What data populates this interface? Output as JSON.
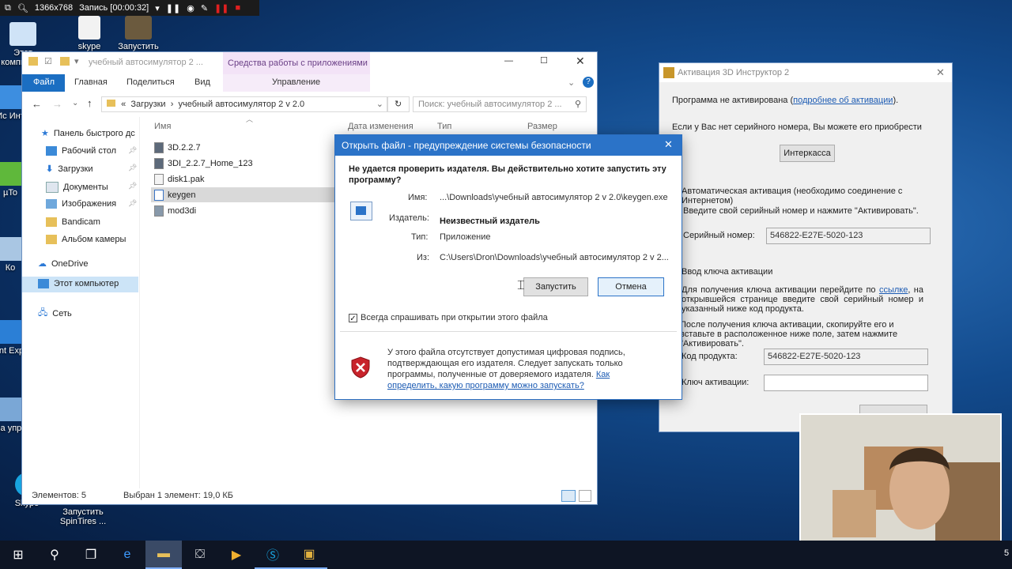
{
  "recorder": {
    "resolution": "1366x768",
    "status": "Запись [00:00:32]"
  },
  "desktop": {
    "icons_left": [
      "Этот компьютер",
      "Ис Инт",
      "µTo",
      "Ко",
      "Int Exp",
      "Па упра",
      "Skype"
    ],
    "icons_top": [
      "skype",
      "Запустить"
    ],
    "bottom_icon": "Запустить SpinTires ..."
  },
  "explorer": {
    "title": "учебный автосимулятор 2 ...",
    "context_tab": "Средства работы с приложениями",
    "tabs": [
      "Файл",
      "Главная",
      "Поделиться",
      "Вид"
    ],
    "context_sub": "Управление",
    "breadcrumb": [
      "«",
      "Загрузки",
      "›",
      "учебный автосимулятор 2 v 2.0"
    ],
    "search_placeholder": "Поиск: учебный автосимулятор 2 ...",
    "nav": {
      "quick_access": "Панель быстрого дс",
      "items": [
        "Рабочий стол",
        "Загрузки",
        "Документы",
        "Изображения",
        "Bandicam",
        "Альбом камеры"
      ],
      "onedrive": "OneDrive",
      "this_pc": "Этот компьютер",
      "network": "Сеть"
    },
    "columns": [
      "Имя",
      "Дата изменения",
      "Тип",
      "Размер"
    ],
    "files": [
      "3D.2.2.7",
      "3DI_2.2.7_Home_123",
      "disk1.pak",
      "keygen",
      "mod3di"
    ],
    "status": {
      "count": "Элементов: 5",
      "selected": "Выбран 1 элемент: 19,0 КБ"
    }
  },
  "activation": {
    "title": "Активация 3D Инструктор 2",
    "not_activated": "Программа не активирована (",
    "more_link": "подробнее об активации",
    "after_link": ").",
    "no_serial": "Если у Вас нет серийного номера, Вы можете его приобрести",
    "buy_button": "Интеркасса",
    "auto_header": "Автоматическая активация (необходимо соединение с Интернетом)",
    "enter_serial": "Введите свой серийный номер и нажмите \"Активировать\".",
    "serial_label": "Серийный номер:",
    "serial_value": "546822-E27E-5020-123",
    "manual_header": "Ввод ключа активации",
    "manual_text1": "Для получения ключа активации перейдите по",
    "manual_link": "ссылке",
    "manual_text2": ", на открывшейся странице введите свой серийный номер и указанный ниже код продукта.",
    "manual_text3": "После получения ключа активации, скопируйте его и вставьте в расположенное ниже поле, затем нажмите \"Активировать\".",
    "product_code_label": "Код продукта:",
    "product_code_value": "546822-E27E-5020-123",
    "key_label": "Ключ активации:",
    "key_value": ""
  },
  "dialog": {
    "title": "Открыть файл - предупреждение системы безопасности",
    "question": "Не удается проверить издателя. Вы действительно хотите запустить эту программу?",
    "name_label": "Имя:",
    "name_value": "...\\Downloads\\учебный автосимулятор 2 v 2.0\\keygen.exe",
    "publisher_label": "Издатель:",
    "publisher_value": "Неизвестный издатель",
    "type_label": "Тип:",
    "type_value": "Приложение",
    "from_label": "Из:",
    "from_value": "C:\\Users\\Dron\\Downloads\\учебный автосимулятор 2 v 2...",
    "run_button": "Запустить",
    "cancel_button": "Отмена",
    "always_ask": "Всегда спрашивать при открытии этого файла",
    "always_ask_checked": true,
    "warning_text": "У этого файла отсутствует допустимая цифровая подпись, подтверждающая его издателя. Следует запускать только программы, полученные от доверяемого издателя.",
    "warning_link": "Как определить, какую программу можно запускать?"
  },
  "taskbar": {
    "clock_fragment": "5"
  }
}
